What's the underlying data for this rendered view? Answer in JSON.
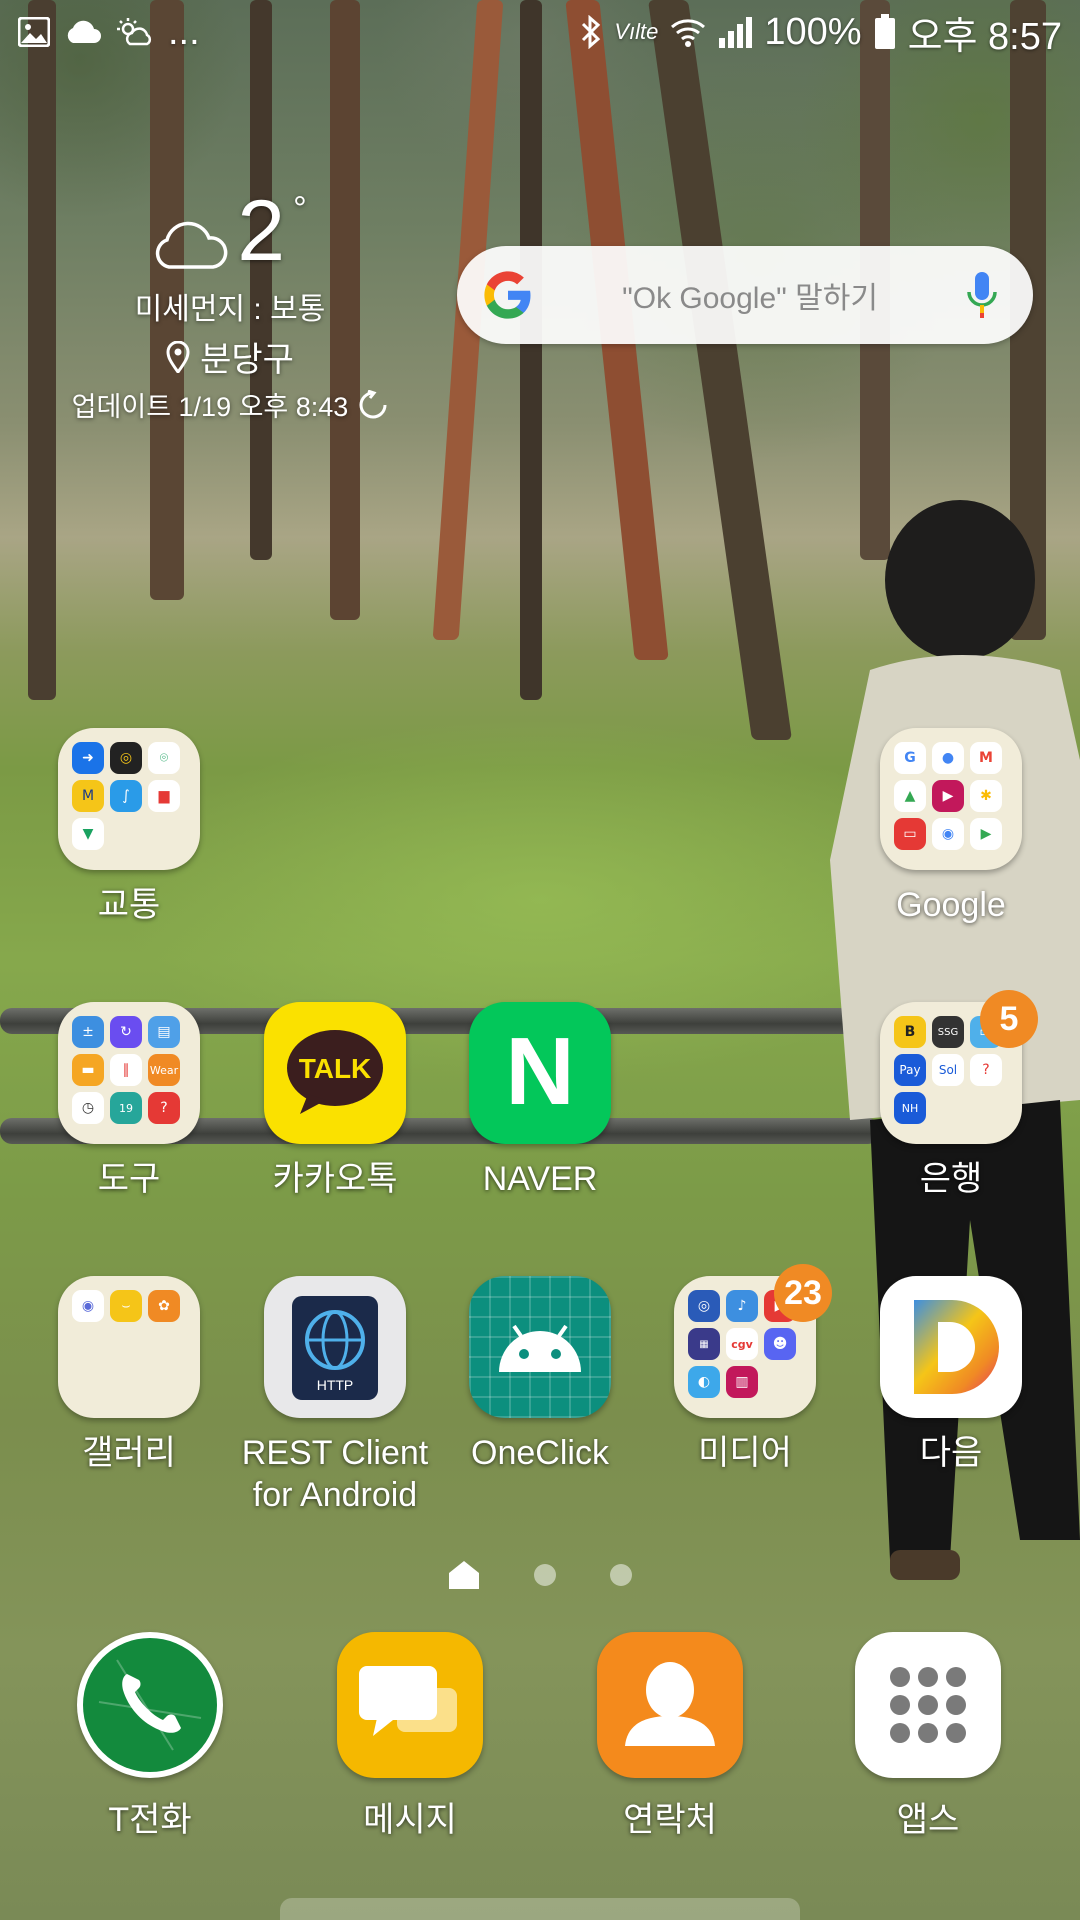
{
  "status_bar": {
    "left_icons": [
      "image-icon",
      "cloud-icon",
      "sun-cloud-icon"
    ],
    "overflow": "...",
    "right_icons": [
      "bluetooth-icon",
      "volte-icon",
      "wifi-icon",
      "signal-icon"
    ],
    "volte_label": "Vılte",
    "battery": "100%",
    "time": "오후 8:57"
  },
  "weather": {
    "temp": "2",
    "deg": "°",
    "dust": "미세먼지 :  보통",
    "location": "분당구",
    "updated": "업데이트 1/19 오후 8:43"
  },
  "search": {
    "placeholder": "\"Ok Google\" 말하기"
  },
  "apps": {
    "transport": {
      "label": "교통"
    },
    "google": {
      "label": "Google"
    },
    "tools": {
      "label": "도구"
    },
    "kakaotalk": {
      "label": "카카오톡",
      "logo": "TALK"
    },
    "naver": {
      "label": "NAVER",
      "logo": "N"
    },
    "bank": {
      "label": "은행",
      "badge": "5"
    },
    "gallery": {
      "label": "갤러리"
    },
    "rest": {
      "label": "REST Client\nfor Android",
      "line1": "REST Client",
      "line2": "for Android",
      "logo": "HTTP"
    },
    "oneclick": {
      "label": "OneClick"
    },
    "media": {
      "label": "미디어",
      "badge": "23"
    },
    "daum": {
      "label": "다음",
      "logo": "D"
    }
  },
  "dock": {
    "phone": {
      "label": "T전화"
    },
    "messages": {
      "label": "메시지"
    },
    "contacts": {
      "label": "연락처"
    },
    "apps": {
      "label": "앱스"
    }
  },
  "page_indicator": {
    "pages": 3,
    "current": 1
  }
}
